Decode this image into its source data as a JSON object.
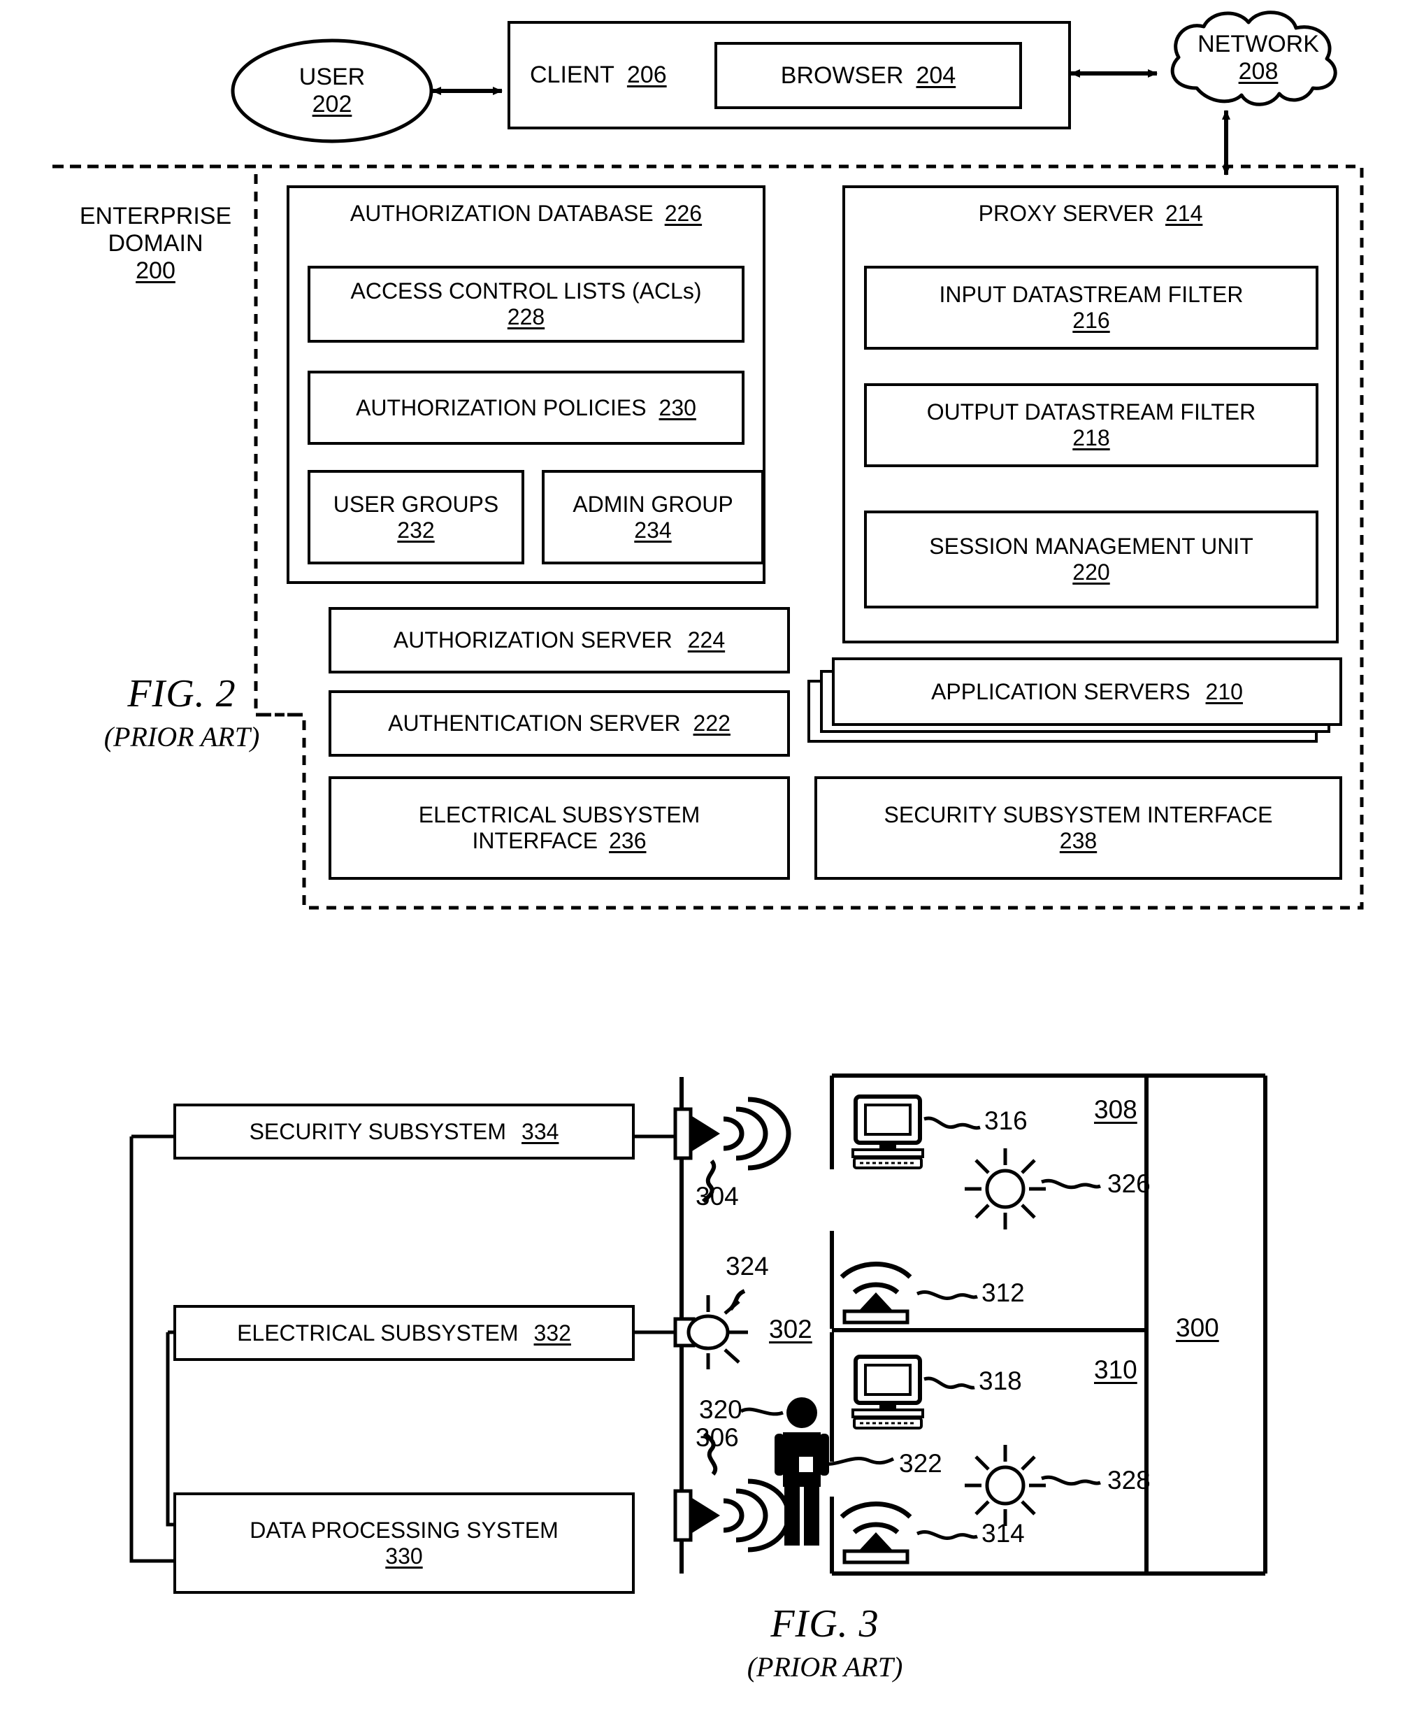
{
  "figures": [
    {
      "id": "fig2",
      "caption_main": "FIG. 2",
      "caption_sub": "(PRIOR ART)",
      "user": {
        "label": "USER",
        "num": "202"
      },
      "client": {
        "label": "CLIENT",
        "num": "206"
      },
      "browser": {
        "label": "BROWSER",
        "num": "204"
      },
      "network": {
        "label": "NETWORK",
        "num": "208"
      },
      "enterprise_domain": {
        "line1": "ENTERPRISE",
        "line2": "DOMAIN",
        "num": "200"
      },
      "auth_db": {
        "label": "AUTHORIZATION DATABASE",
        "num": "226"
      },
      "acls": {
        "label": "ACCESS CONTROL LISTS (ACLs)",
        "num": "228"
      },
      "auth_policies": {
        "label": "AUTHORIZATION POLICIES",
        "num": "230"
      },
      "user_groups": {
        "label": "USER GROUPS",
        "num": "232"
      },
      "admin_group": {
        "label": "ADMIN GROUP",
        "num": "234"
      },
      "proxy_server": {
        "label": "PROXY SERVER",
        "num": "214"
      },
      "input_filter": {
        "label": "INPUT DATASTREAM FILTER",
        "num": "216"
      },
      "output_filter": {
        "label": "OUTPUT DATASTREAM FILTER",
        "num": "218"
      },
      "session_mgmt": {
        "label": "SESSION MANAGEMENT UNIT",
        "num": "220"
      },
      "authz_server": {
        "label": "AUTHORIZATION SERVER",
        "num": "224"
      },
      "authn_server": {
        "label": "AUTHENTICATION SERVER",
        "num": "222"
      },
      "app_servers": {
        "label": "APPLICATION SERVERS",
        "num": "210"
      },
      "elec_iface": {
        "line1": "ELECTRICAL SUBSYSTEM",
        "line2": "INTERFACE",
        "num": "236"
      },
      "sec_iface": {
        "label": "SECURITY SUBSYSTEM INTERFACE",
        "num": "238"
      }
    },
    {
      "id": "fig3",
      "caption_main": "FIG. 3",
      "caption_sub": "(PRIOR ART)",
      "security_subsystem": {
        "label": "SECURITY SUBSYSTEM",
        "num": "334"
      },
      "electrical_subsystem": {
        "label": "ELECTRICAL SUBSYSTEM",
        "num": "332"
      },
      "data_processing_system": {
        "label": "DATA PROCESSING SYSTEM",
        "num": "330"
      },
      "refs": [
        {
          "name": "speaker-top",
          "num": "304",
          "underline": false
        },
        {
          "name": "speaker-bottom",
          "num": "306",
          "underline": false
        },
        {
          "name": "wall-light",
          "num": "324",
          "underline": false
        },
        {
          "name": "corridor",
          "num": "302",
          "underline": true
        },
        {
          "name": "person",
          "num": "320",
          "underline": false
        },
        {
          "name": "badge",
          "num": "322",
          "underline": false
        },
        {
          "name": "computer-room-308",
          "num": "316",
          "underline": false
        },
        {
          "name": "room-308",
          "num": "308",
          "underline": true
        },
        {
          "name": "light-room-308",
          "num": "326",
          "underline": false
        },
        {
          "name": "sensor-312",
          "num": "312",
          "underline": false
        },
        {
          "name": "building",
          "num": "300",
          "underline": true
        },
        {
          "name": "computer-room-310",
          "num": "318",
          "underline": false
        },
        {
          "name": "room-310",
          "num": "310",
          "underline": true
        },
        {
          "name": "light-room-310",
          "num": "328",
          "underline": false
        },
        {
          "name": "sensor-314",
          "num": "314",
          "underline": false
        }
      ]
    }
  ]
}
